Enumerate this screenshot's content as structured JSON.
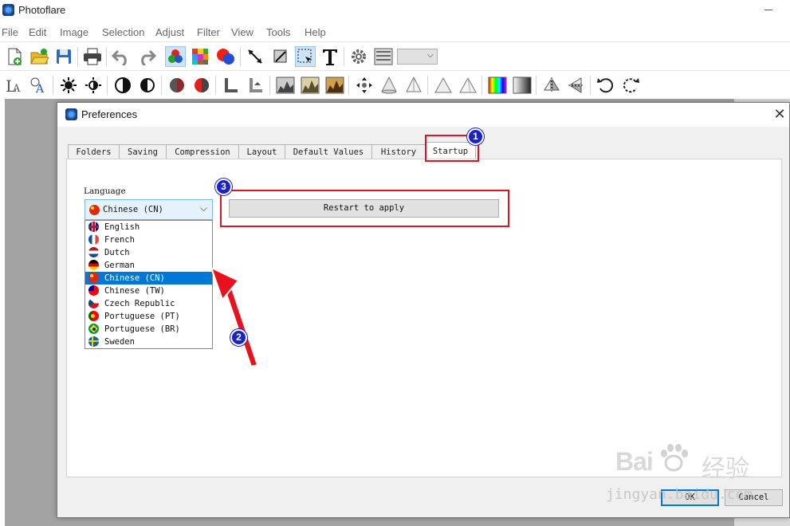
{
  "app": {
    "title": "Photoflare"
  },
  "menu": [
    "File",
    "Edit",
    "Image",
    "Selection",
    "Adjust",
    "Filter",
    "View",
    "Tools",
    "Help"
  ],
  "toolbar1": [
    "new-file-icon",
    "open-folder-icon",
    "save-icon",
    "print-icon",
    "undo-icon",
    "redo-icon",
    "colors-icon",
    "palette-icon",
    "color-picker-icon",
    "line-tool-icon",
    "crop-icon",
    "select-tool-icon",
    "text-tool-icon",
    "settings-icon",
    "layers-icon",
    "zoom-dropdown"
  ],
  "toolbar2": [
    "font-size-icon",
    "font-color-icon",
    "brightness-down-icon",
    "brightness-up-icon",
    "contrast-down-icon",
    "contrast-up-icon",
    "saturation-down-icon",
    "saturation-up-icon",
    "levels-down-icon",
    "levels-up-icon",
    "histogram-icon",
    "histogram-auto-icon",
    "histogram-warm-icon",
    "move-icon",
    "cone-icon",
    "cone-outline-icon",
    "triangle-icon",
    "triangle-outline-icon",
    "gradient-color-icon",
    "gradient-gray-icon",
    "flip-horizontal-icon",
    "flip-vertical-icon",
    "rotate-left-icon",
    "rotate-right-icon"
  ],
  "dialog": {
    "title": "Preferences",
    "tabs": [
      "Folders",
      "Saving",
      "Compression",
      "Layout",
      "Default Values",
      "History",
      "Startup"
    ],
    "active_tab": "Startup",
    "language_label": "Language",
    "language_selected": "Chinese (CN)",
    "languages": [
      {
        "label": "English",
        "flag": "en"
      },
      {
        "label": "French",
        "flag": "fr"
      },
      {
        "label": "Dutch",
        "flag": "nl"
      },
      {
        "label": "German",
        "flag": "de"
      },
      {
        "label": "Chinese (CN)",
        "flag": "cn"
      },
      {
        "label": "Chinese (TW)",
        "flag": "tw"
      },
      {
        "label": "Czech Republic",
        "flag": "cz"
      },
      {
        "label": "Portuguese (PT)",
        "flag": "pt"
      },
      {
        "label": "Portuguese (BR)",
        "flag": "br"
      },
      {
        "label": "Sweden",
        "flag": "se"
      }
    ],
    "restart_button": "Restart to apply",
    "ok_button": "OK",
    "cancel_button": "Cancel"
  },
  "annotations": {
    "badge1": "1",
    "badge2": "2",
    "badge3": "3",
    "highlight_color": "#e0141e",
    "badge_color": "#1a23c7"
  },
  "watermark": {
    "brand": "Bai",
    "brand_cn": "经验",
    "url": "jingyan.baidu.com"
  }
}
